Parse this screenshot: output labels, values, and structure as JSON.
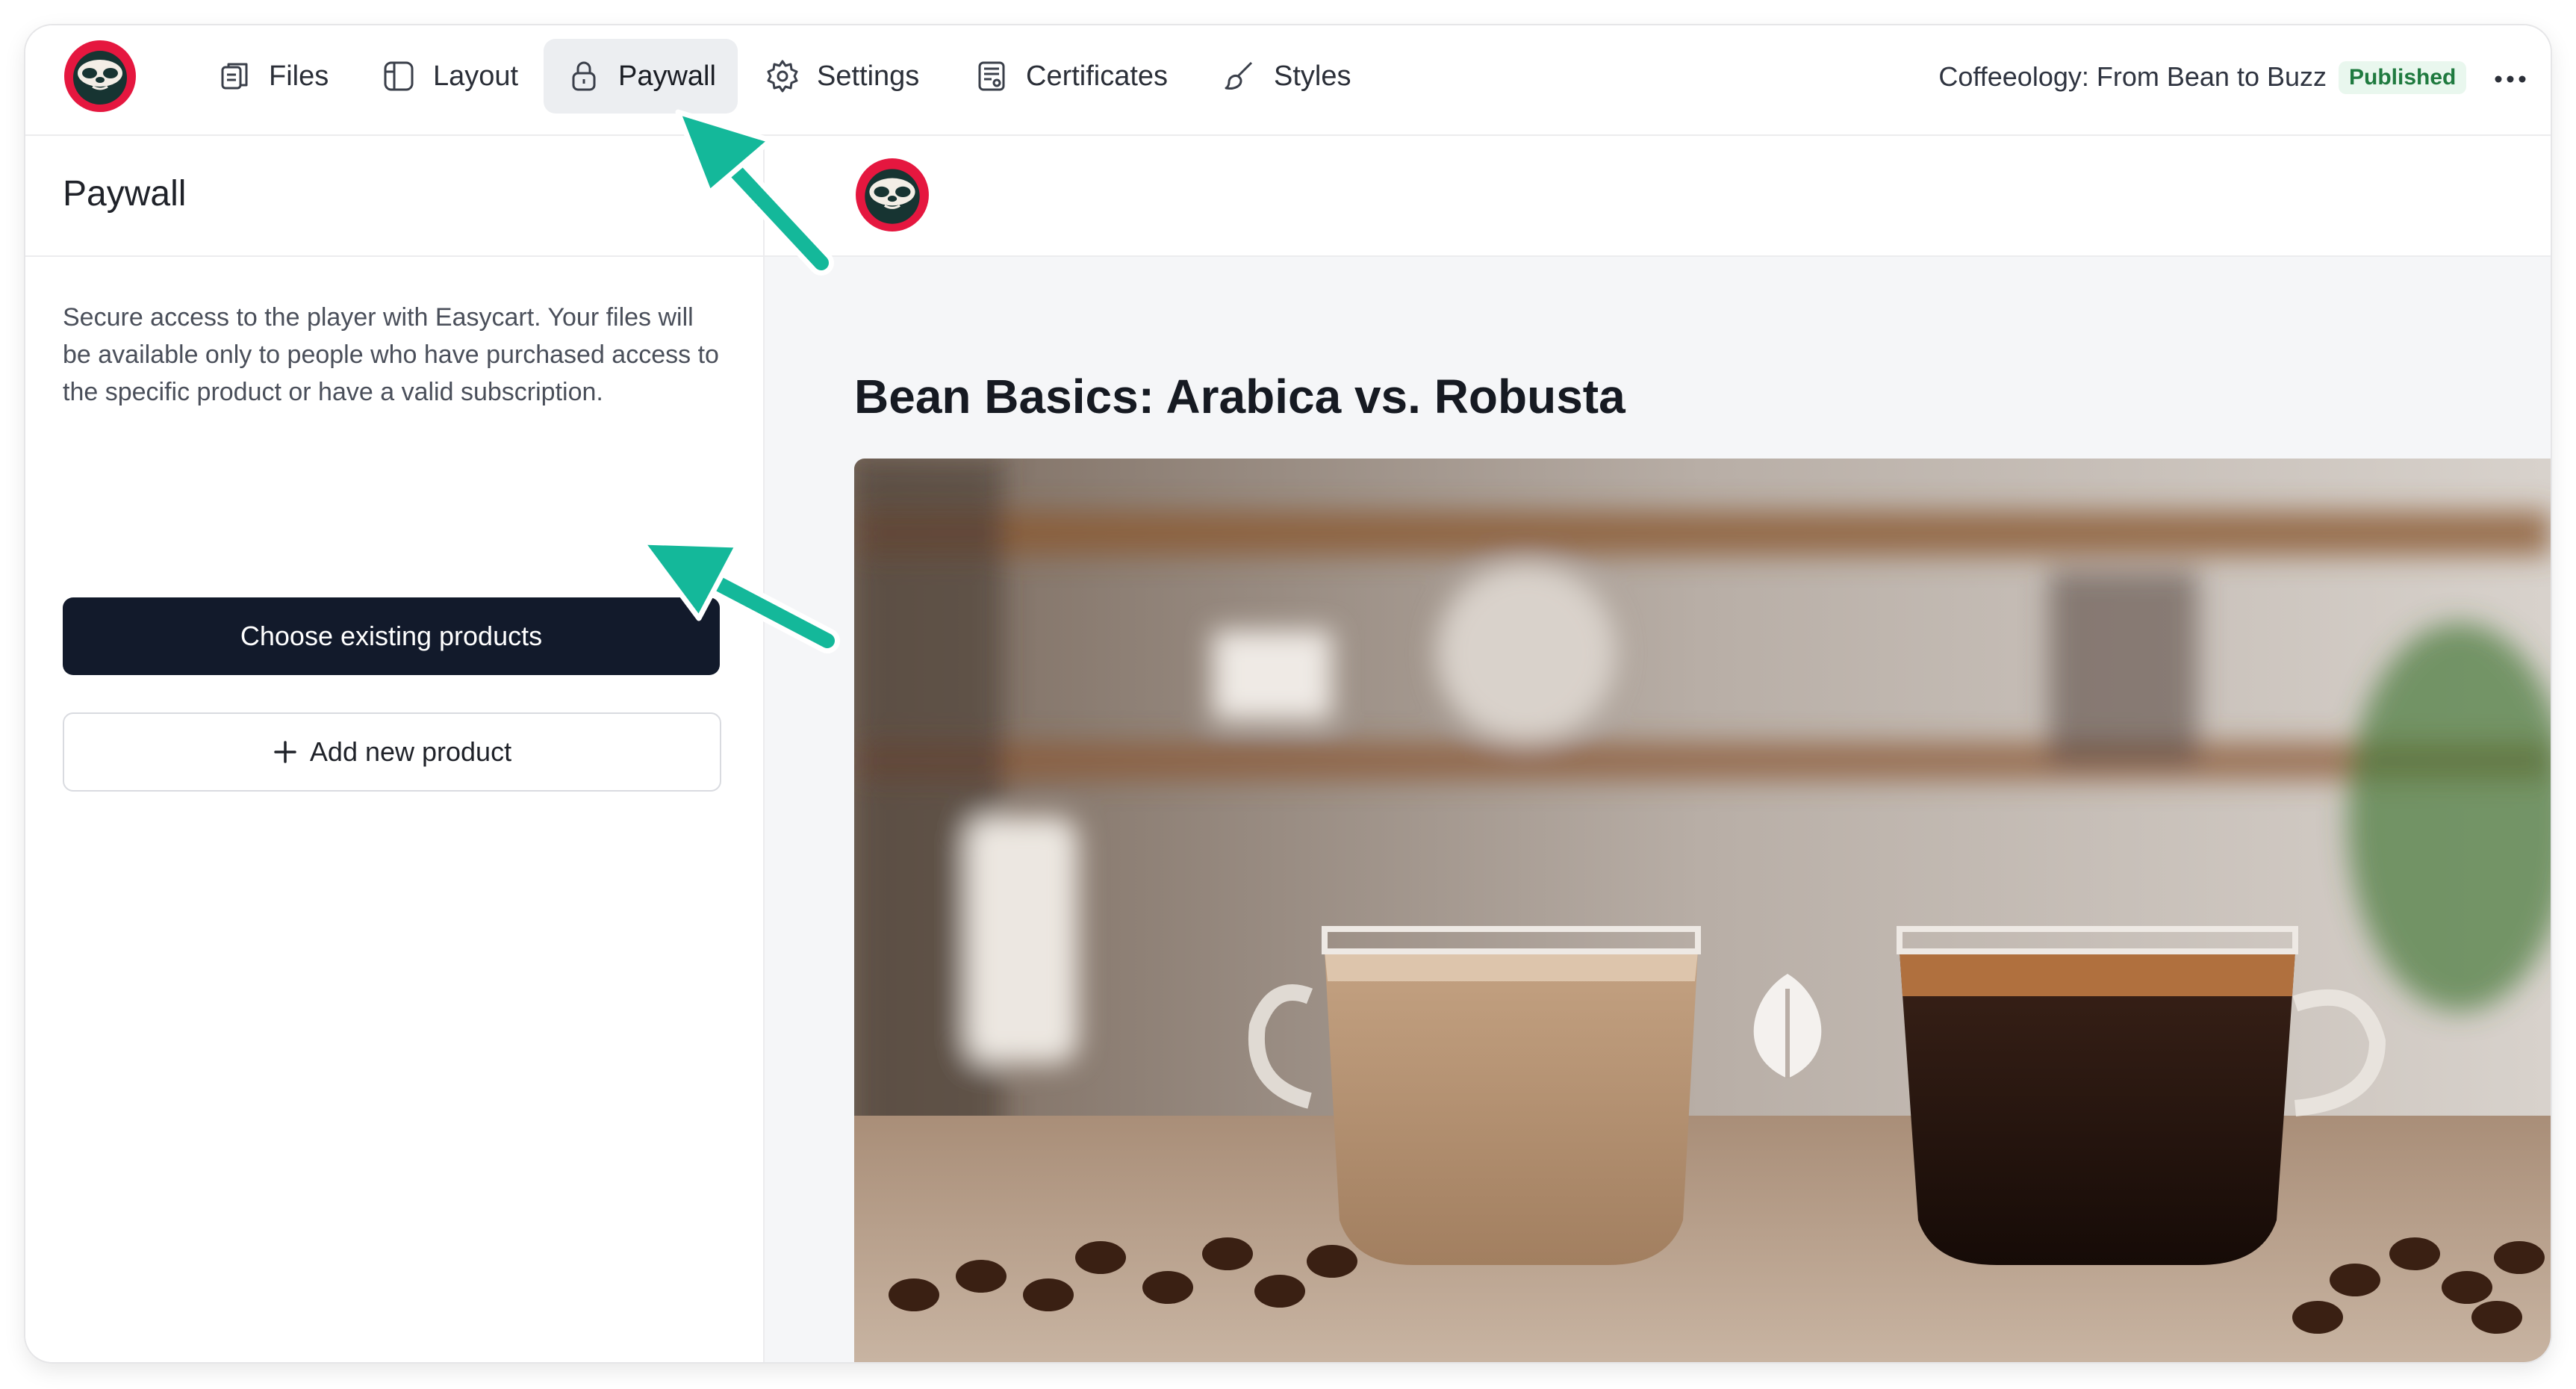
{
  "nav": {
    "items": [
      {
        "label": "Files",
        "icon": "files-icon"
      },
      {
        "label": "Layout",
        "icon": "layout-icon"
      },
      {
        "label": "Paywall",
        "icon": "lock-icon",
        "active": true
      },
      {
        "label": "Settings",
        "icon": "gear-icon"
      },
      {
        "label": "Certificates",
        "icon": "certificate-icon"
      },
      {
        "label": "Styles",
        "icon": "brush-icon"
      }
    ],
    "course_title": "Coffeeology: From Bean to Buzz",
    "status": "Published"
  },
  "paywall_panel": {
    "title": "Paywall",
    "description": "Secure access to the player with Easycart. Your files will be available only to people who have purchased access to the specific product or have a valid subscription.",
    "choose_button": "Choose existing products",
    "add_button": "Add new product"
  },
  "preview": {
    "lesson_title": "Bean Basics: Arabica vs. Robusta"
  },
  "colors": {
    "brand_red": "#e5173f",
    "primary_button": "#121a2b",
    "annotation_arrow": "#14b89a",
    "published_bg": "#e9f7ee",
    "published_text": "#1f7a3f"
  }
}
